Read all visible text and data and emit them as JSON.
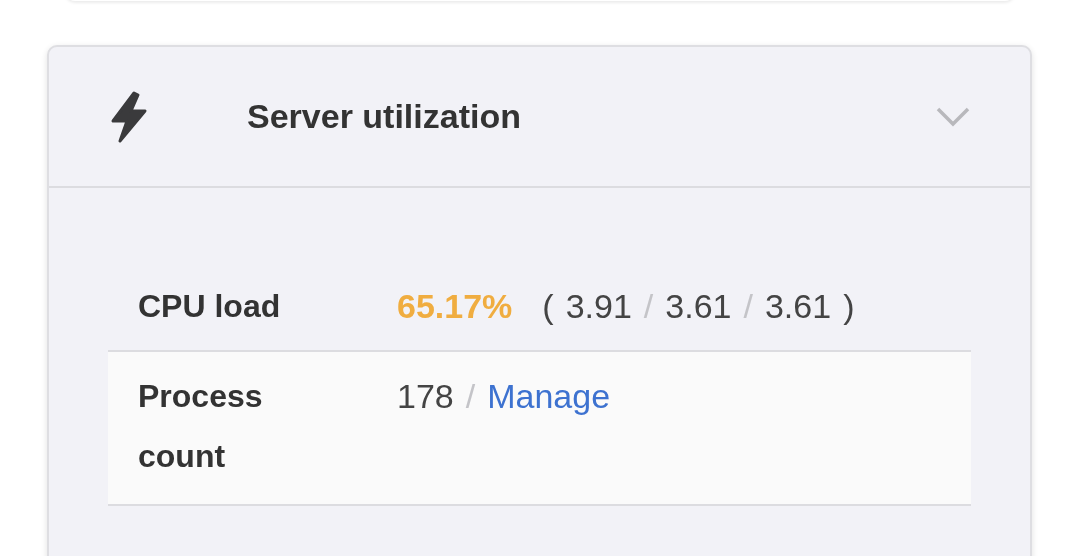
{
  "panel": {
    "title": "Server utilization",
    "expanded": true,
    "rows": [
      {
        "kind": "load",
        "label": "CPU load",
        "percent": "65.17%",
        "open_paren": "(",
        "averages": [
          "3.91",
          "3.61",
          "3.61"
        ],
        "separator": "/",
        "close_paren": ")"
      },
      {
        "kind": "count",
        "label": "Process count",
        "count": "178",
        "separator": "/",
        "link": "Manage"
      }
    ]
  }
}
